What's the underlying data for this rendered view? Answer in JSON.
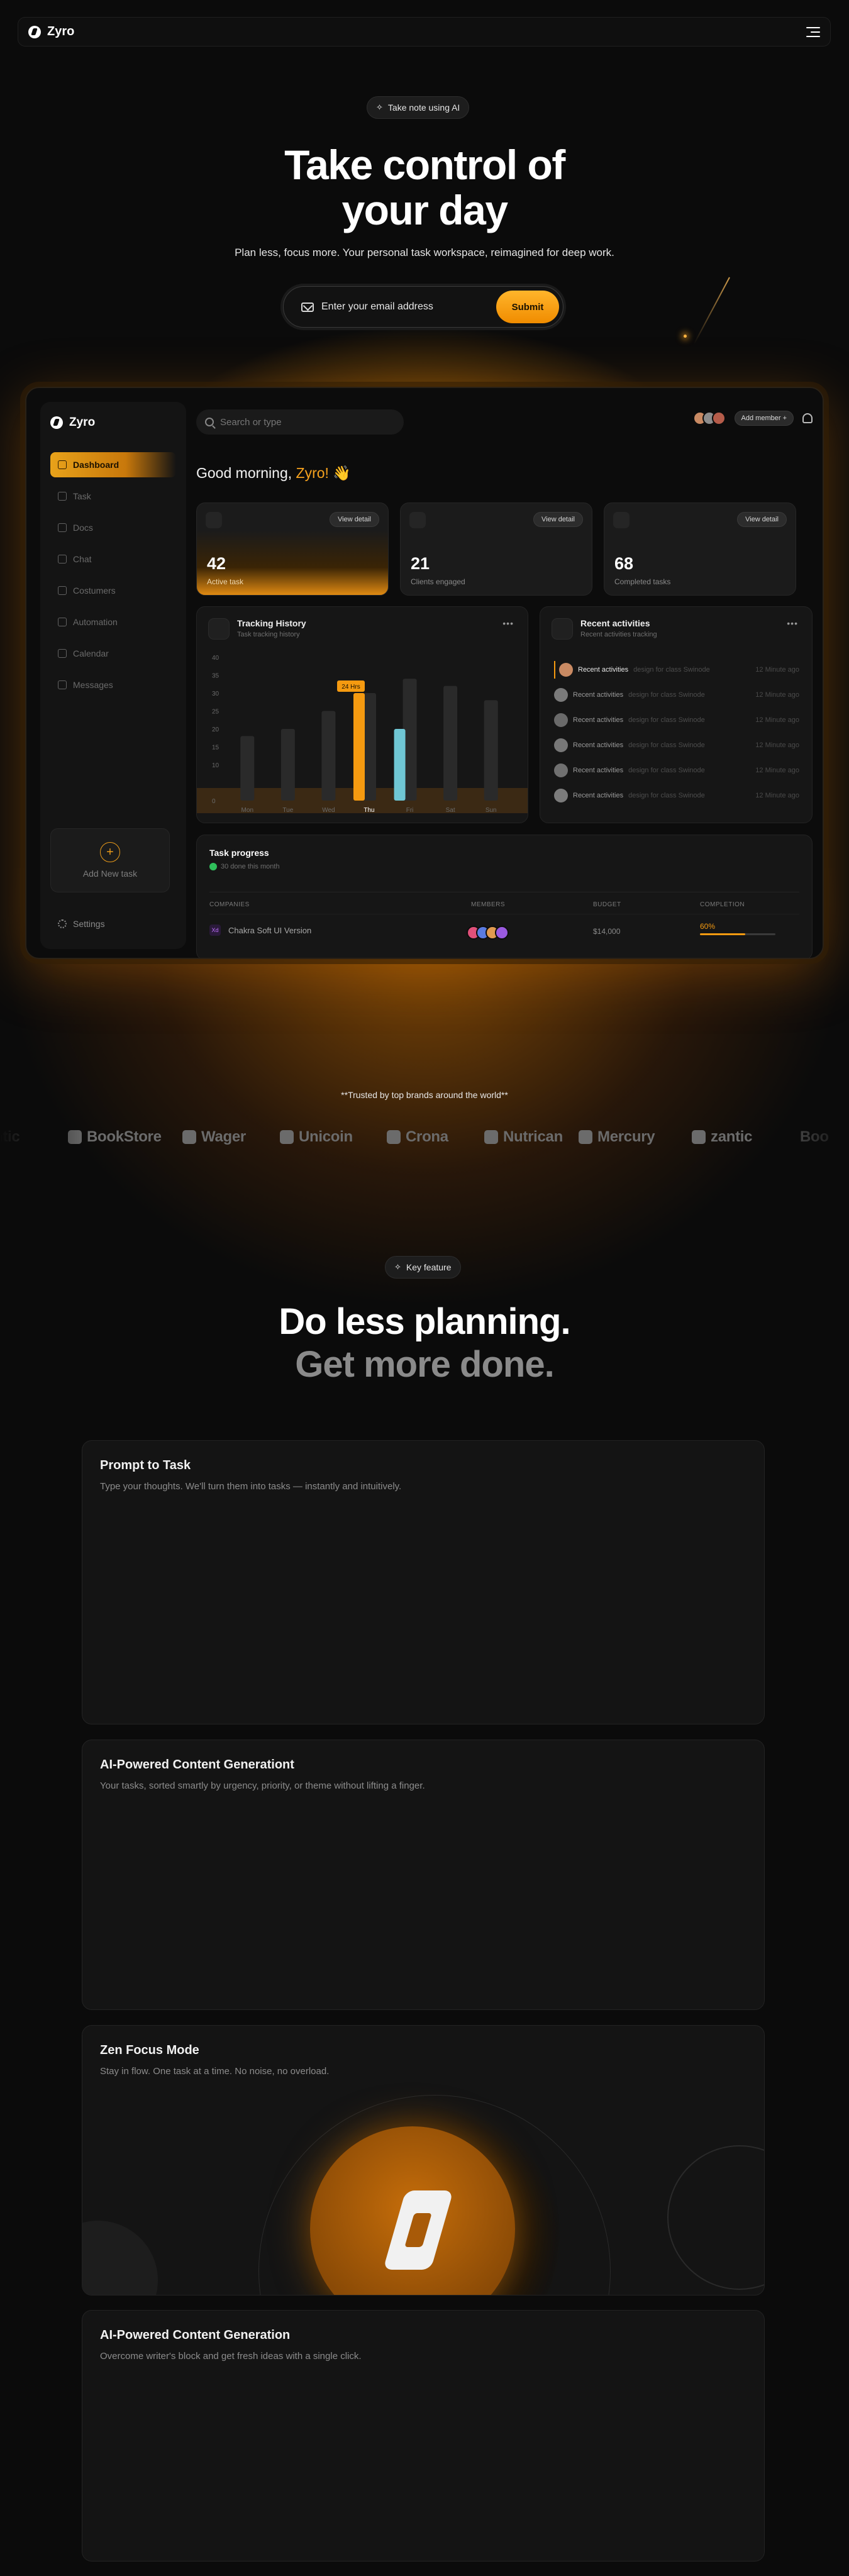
{
  "nav": {
    "brand": "Zyro",
    "menu_icon": "hamburger-icon"
  },
  "hero": {
    "badge": "Take note using AI",
    "title_line1": "Take control of",
    "title_line2": "your day",
    "subtitle": "Plan less, focus more.  Your personal task workspace, reimagined for deep work.",
    "email_placeholder": "Enter your email address",
    "submit_label": "Submit"
  },
  "dashboard": {
    "brand": "Zyro",
    "sidebar": [
      {
        "label": "Dashboard",
        "icon": "grid-icon",
        "active": true
      },
      {
        "label": "Task",
        "icon": "task-icon",
        "active": false
      },
      {
        "label": "Docs",
        "icon": "docs-icon",
        "active": false
      },
      {
        "label": "Chat",
        "icon": "chat-icon",
        "active": false
      },
      {
        "label": "Costumers",
        "icon": "users-icon",
        "active": false
      },
      {
        "label": "Automation",
        "icon": "automation-icon",
        "active": false
      },
      {
        "label": "Calendar",
        "icon": "calendar-icon",
        "active": false
      },
      {
        "label": "Messages",
        "icon": "messages-icon",
        "active": false
      }
    ],
    "add_task": "Add New task",
    "settings": "Settings",
    "search_placeholder": "Search or type",
    "add_member": "Add member",
    "greeting": "Good morning,",
    "greeting_name": "Zyro!",
    "greeting_emoji": "👋",
    "view_detail": "View detail",
    "stats": [
      {
        "value": "42",
        "label": "Active task"
      },
      {
        "value": "21",
        "label": "Clients engaged"
      },
      {
        "value": "68",
        "label": "Completed tasks"
      }
    ],
    "tracking": {
      "title": "Tracking History",
      "subtitle": "Task tracking history",
      "more": "•••"
    },
    "recent": {
      "title": "Recent activities",
      "subtitle": "Recent activities tracking",
      "more": "•••"
    },
    "activities": [
      {
        "title": "Recent activities",
        "desc": "design for class Swinode",
        "time": "12 Minute ago"
      },
      {
        "title": "Recent activities",
        "desc": "design for class Swinode",
        "time": "12 Minute ago"
      },
      {
        "title": "Recent activities",
        "desc": "design for class Swinode",
        "time": "12 Minute ago"
      },
      {
        "title": "Recent activities",
        "desc": "design for class Swinode",
        "time": "12 Minute ago"
      },
      {
        "title": "Recent activities",
        "desc": "design for class Swinode",
        "time": "12 Minute ago"
      },
      {
        "title": "Recent activities",
        "desc": "design for class Swinode",
        "time": "12 Minute ago"
      }
    ],
    "task_progress": {
      "title": "Task progress",
      "subtitle": "30 done this month",
      "headers": [
        "COMPANIES",
        "MEMBERS",
        "BUDGET",
        "COMPLETION"
      ],
      "row": {
        "company": "Chakra Soft UI Version",
        "budget": "$14,000",
        "completion": "60%"
      },
      "completion_fraction": 0.6
    }
  },
  "chart_data": {
    "type": "bar",
    "categories": [
      "Mon",
      "Tue",
      "Wed",
      "Thu",
      "Fri",
      "Sat",
      "Sun"
    ],
    "yticks": [
      "0",
      "10",
      "15",
      "20",
      "25",
      "30",
      "35",
      "40"
    ],
    "ylim": [
      0,
      40
    ],
    "highlight_label": "24 Hrs",
    "series": [
      {
        "values": [
          18,
          20,
          25,
          30,
          34,
          32,
          28
        ],
        "color": "#2a2a2a"
      },
      {
        "values": [
          0,
          0,
          0,
          30,
          20,
          0,
          0
        ],
        "color": "#f59a10"
      }
    ]
  },
  "trust": {
    "text": "**Trusted by top brands around the world**",
    "logos": [
      "ntic",
      "BookStore",
      "Wager",
      "Unicoin",
      "Crona",
      "Nutrican",
      "Mercury",
      "zantic",
      "Boo"
    ]
  },
  "features": {
    "badge": "Key feature",
    "title_line1": "Do less planning.",
    "title_line2": "Get more done.",
    "cards": [
      {
        "title": "Prompt to Task",
        "desc": "Type your thoughts. We'll turn them into tasks — instantly and intuitively."
      },
      {
        "title": "AI-Powered Content Generationt",
        "desc": "Your tasks, sorted smartly by urgency, priority, or theme  without lifting a finger."
      },
      {
        "title": "Zen Focus Mode",
        "desc": "Stay in flow. One task at a time. No noise, no overload."
      },
      {
        "title": "AI-Powered Content Generation",
        "desc": "Overcome writer's block and get fresh ideas with a single click."
      }
    ]
  },
  "colors": {
    "accent": "#f59a10",
    "background": "#0b0b0b",
    "card": "#141414"
  }
}
